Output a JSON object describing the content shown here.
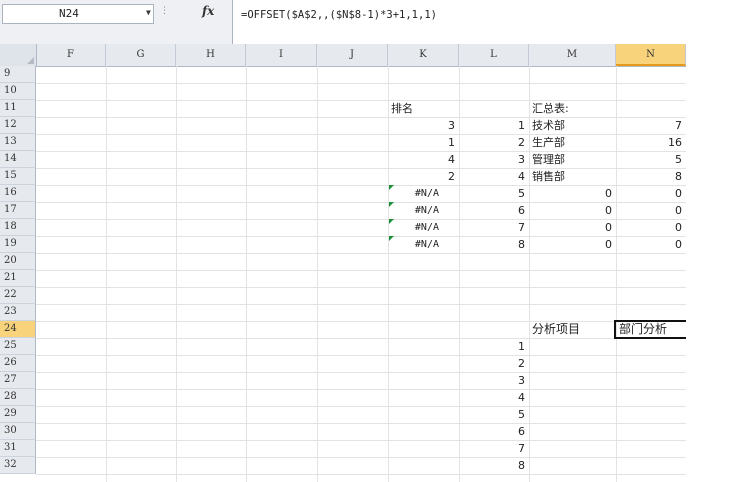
{
  "formula_bar": {
    "name_box": "N24",
    "fx_label": "fx",
    "formula": "=OFFSET($A$2,,($N$8-1)*3+1,1,1)"
  },
  "columns": [
    "F",
    "G",
    "H",
    "I",
    "J",
    "K",
    "L",
    "M",
    "N"
  ],
  "selected_column": "N",
  "rows": [
    "9",
    "10",
    "11",
    "12",
    "13",
    "14",
    "15",
    "16",
    "17",
    "18",
    "19",
    "20",
    "21",
    "22",
    "23",
    "24",
    "25",
    "26",
    "27",
    "28",
    "29",
    "30",
    "31",
    "32"
  ],
  "selected_row": "24",
  "cells": {
    "K11": "排名",
    "M11": "汇总表:",
    "K12": "3",
    "K13": "1",
    "K14": "4",
    "K15": "2",
    "K16": "#N/A",
    "K17": "#N/A",
    "K18": "#N/A",
    "K19": "#N/A",
    "L12": "1",
    "L13": "2",
    "L14": "3",
    "L15": "4",
    "L16": "5",
    "L17": "6",
    "L18": "7",
    "L19": "8",
    "M12": "技术部",
    "M13": "生产部",
    "M14": "管理部",
    "M15": "销售部",
    "M16": "0",
    "M17": "0",
    "M18": "0",
    "M19": "0",
    "N12": "7",
    "N13": "16",
    "N14": "5",
    "N15": "8",
    "N16": "0",
    "N17": "0",
    "N18": "0",
    "N19": "0",
    "M24": "分析项目",
    "N24": "部门分析",
    "L25": "1",
    "L26": "2",
    "L27": "3",
    "L28": "4",
    "L29": "5",
    "L30": "6",
    "L31": "7",
    "L32": "8"
  },
  "colors": {
    "selected_header": "#f8d37b",
    "error_marker": "#1e8f3a"
  }
}
